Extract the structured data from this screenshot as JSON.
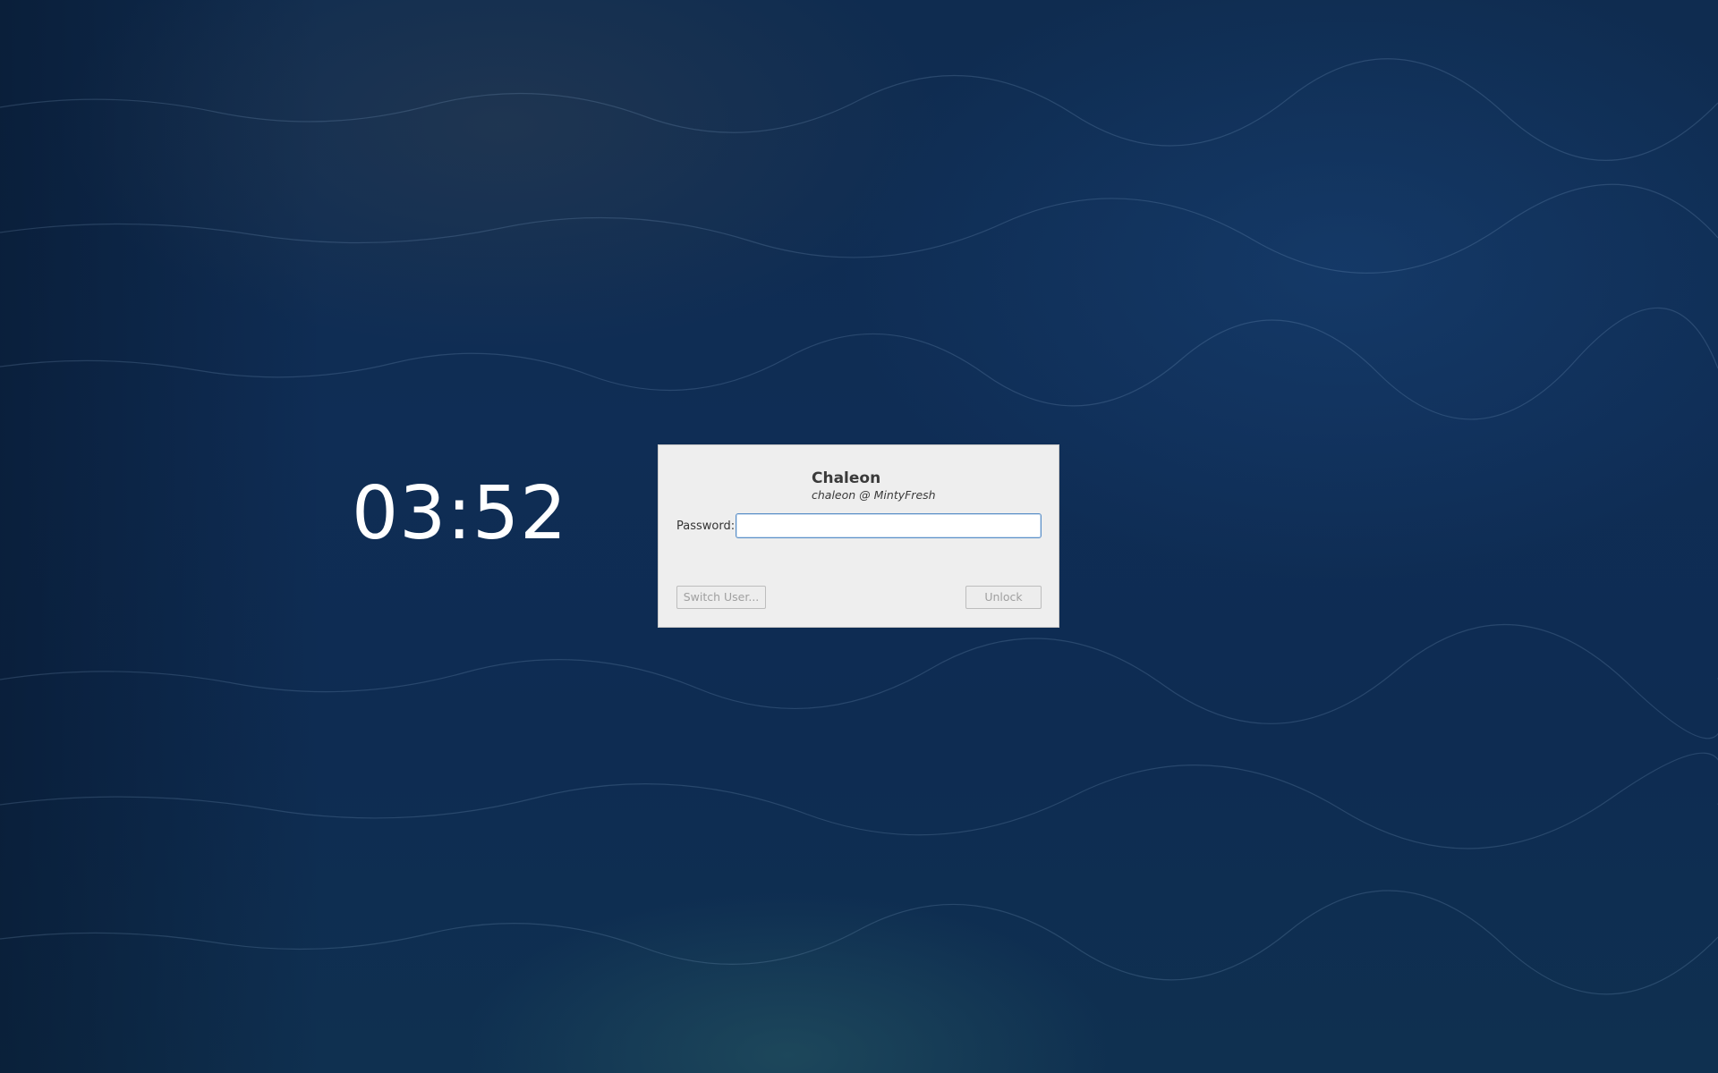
{
  "lockscreen": {
    "clock": "03:52",
    "user": {
      "display_name": "Chaleon",
      "user_at_host": "chaleon @ MintyFresh"
    },
    "password": {
      "label": "Password:",
      "value": "",
      "placeholder": ""
    },
    "buttons": {
      "switch_user": "Switch User...",
      "unlock": "Unlock"
    }
  },
  "colors": {
    "background": "#0e2a4a",
    "dialog": "#eeeeee",
    "input_focus_border": "#5b8fc7",
    "disabled_text": "#a0a0a0"
  }
}
